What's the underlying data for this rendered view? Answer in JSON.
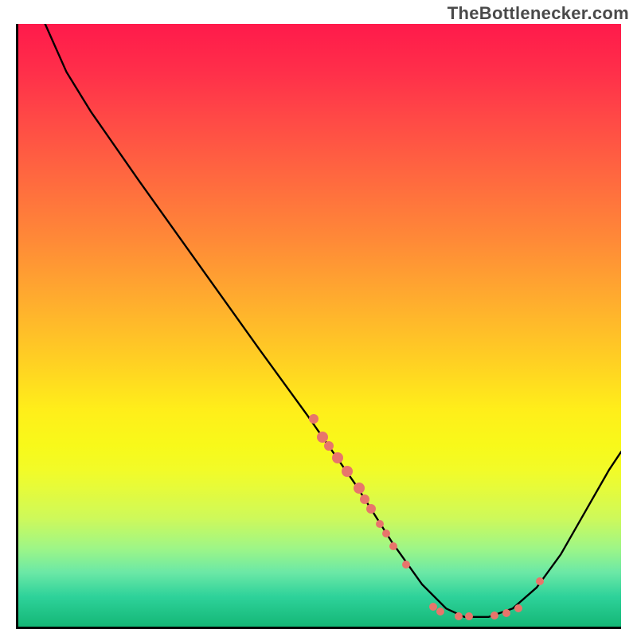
{
  "attribution": "TheBottlenecker.com",
  "chart_data": {
    "type": "line",
    "title": "",
    "xlabel": "",
    "ylabel": "",
    "xlim": [
      0,
      100
    ],
    "ylim": [
      0,
      100
    ],
    "curve": [
      {
        "x": 4.0,
        "y": 101.0
      },
      {
        "x": 8.0,
        "y": 92.0
      },
      {
        "x": 12.0,
        "y": 85.5
      },
      {
        "x": 20.0,
        "y": 74.0
      },
      {
        "x": 30.0,
        "y": 60.0
      },
      {
        "x": 40.0,
        "y": 46.0
      },
      {
        "x": 48.0,
        "y": 35.0
      },
      {
        "x": 56.0,
        "y": 23.5
      },
      {
        "x": 62.0,
        "y": 14.0
      },
      {
        "x": 67.0,
        "y": 7.0
      },
      {
        "x": 71.0,
        "y": 3.0
      },
      {
        "x": 74.0,
        "y": 1.6
      },
      {
        "x": 78.0,
        "y": 1.6
      },
      {
        "x": 82.0,
        "y": 3.0
      },
      {
        "x": 86.0,
        "y": 6.5
      },
      {
        "x": 90.0,
        "y": 12.0
      },
      {
        "x": 94.0,
        "y": 19.0
      },
      {
        "x": 98.0,
        "y": 26.0
      },
      {
        "x": 100.0,
        "y": 29.0
      }
    ],
    "markers": [
      {
        "x": 49.0,
        "y": 34.5,
        "r": 6
      },
      {
        "x": 50.5,
        "y": 31.5,
        "r": 7
      },
      {
        "x": 51.5,
        "y": 30.0,
        "r": 6
      },
      {
        "x": 53.0,
        "y": 28.0,
        "r": 7
      },
      {
        "x": 54.5,
        "y": 25.8,
        "r": 7
      },
      {
        "x": 56.5,
        "y": 23.0,
        "r": 7
      },
      {
        "x": 57.5,
        "y": 21.2,
        "r": 6
      },
      {
        "x": 58.5,
        "y": 19.5,
        "r": 6
      },
      {
        "x": 60.0,
        "y": 17.0,
        "r": 5
      },
      {
        "x": 61.0,
        "y": 15.5,
        "r": 5
      },
      {
        "x": 62.2,
        "y": 13.3,
        "r": 5
      },
      {
        "x": 64.3,
        "y": 10.3,
        "r": 5
      },
      {
        "x": 68.8,
        "y": 3.3,
        "r": 5
      },
      {
        "x": 70.0,
        "y": 2.5,
        "r": 5
      },
      {
        "x": 73.0,
        "y": 1.7,
        "r": 5
      },
      {
        "x": 74.8,
        "y": 1.7,
        "r": 5
      },
      {
        "x": 79.0,
        "y": 1.9,
        "r": 5
      },
      {
        "x": 81.0,
        "y": 2.2,
        "r": 5
      },
      {
        "x": 83.0,
        "y": 3.0,
        "r": 5
      },
      {
        "x": 86.5,
        "y": 7.5,
        "r": 5
      }
    ],
    "marker_color": "#e8756b",
    "line_color": "#000000"
  }
}
